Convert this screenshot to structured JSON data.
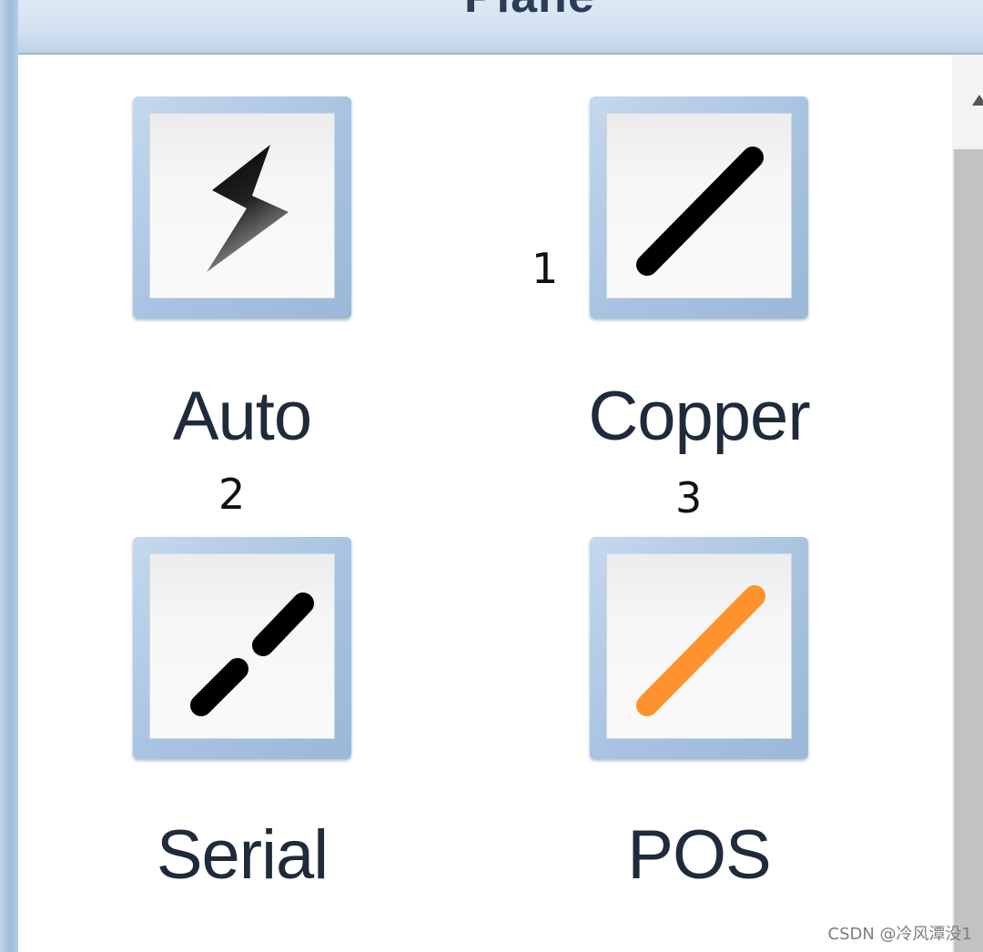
{
  "title_bar": {
    "title": "Plane"
  },
  "tools": [
    {
      "label": "Auto",
      "icon": "lightning-bolt-icon"
    },
    {
      "label": "Copper",
      "icon": "solid-diagonal-line-icon",
      "color": "#000000"
    },
    {
      "label": "Serial",
      "icon": "dashed-diagonal-line-icon",
      "color": "#000000"
    },
    {
      "label": "POS",
      "icon": "orange-diagonal-line-icon",
      "color": "#ff922c"
    }
  ],
  "markers": [
    "1",
    "2",
    "3"
  ],
  "watermark": "CSDN @冷风潭没1"
}
